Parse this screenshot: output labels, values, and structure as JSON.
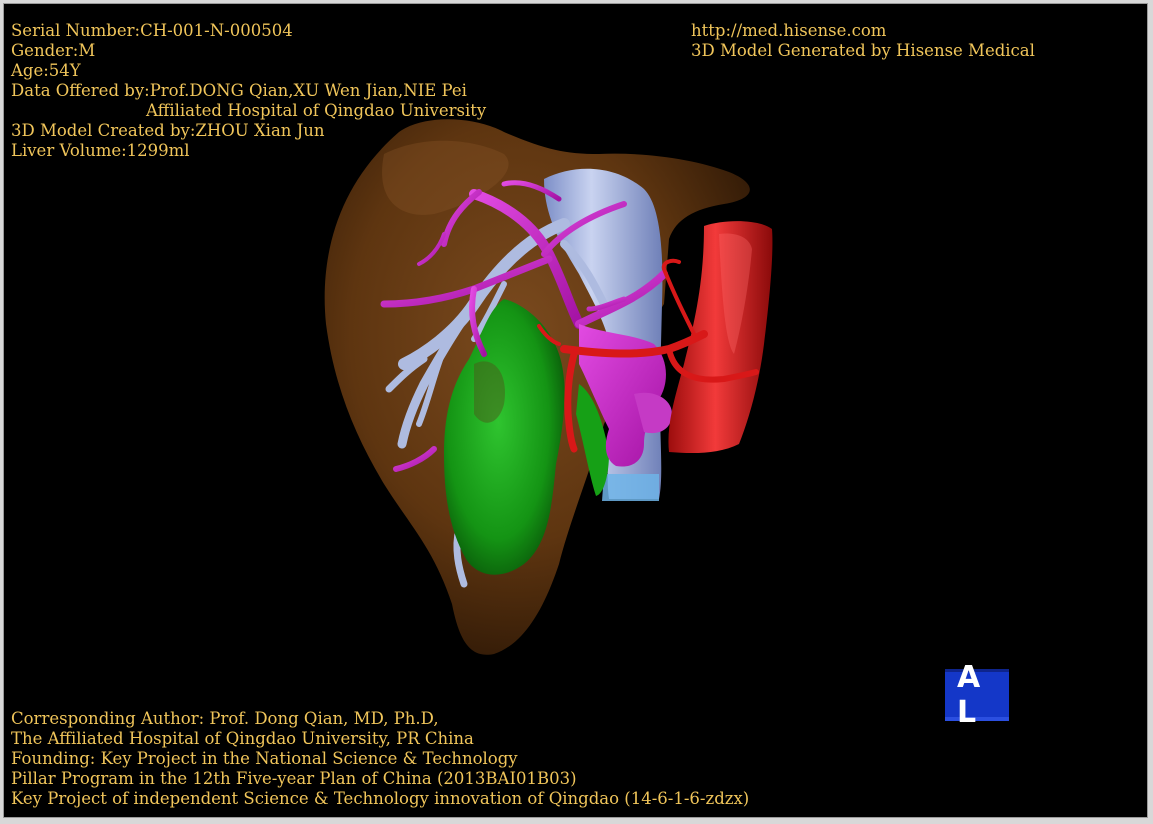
{
  "header_left": {
    "serial": "Serial Number:CH-001-N-000504",
    "gender": "Gender:M",
    "age": "Age:54Y",
    "data_offered": "Data Offered by:Prof.DONG Qian,XU Wen Jian,NIE Pei",
    "hospital": "Affiliated Hospital of Qingdao University",
    "created_by": "3D Model Created by:ZHOU Xian Jun",
    "volume": "Liver Volume:1299ml"
  },
  "header_right": {
    "url": "http://med.hisense.com",
    "generated_by": "3D Model Generated by Hisense Medical"
  },
  "footer": {
    "line1": "Corresponding Author: Prof. Dong Qian, MD, Ph.D,",
    "line2": "The Affiliated Hospital of Qingdao University, PR China",
    "line3": "Founding: Key Project in the National Science & Technology",
    "line4": "Pillar Program in the 12th Five-year Plan of China (2013BAI01B03)",
    "line5": "Key Project of independent Science & Technology innovation of Qingdao (14-6-1-6-zdzx)"
  },
  "orientation_cube": {
    "label": "A L"
  },
  "colors": {
    "text": "#f0c55a",
    "liver": "#6b3d14",
    "portal_vein": "#cc33cc",
    "hepatic_vein": "#b8c4e8",
    "artery": "#e01818",
    "lesion": "#1fa81f",
    "cube": "#1437c8"
  }
}
